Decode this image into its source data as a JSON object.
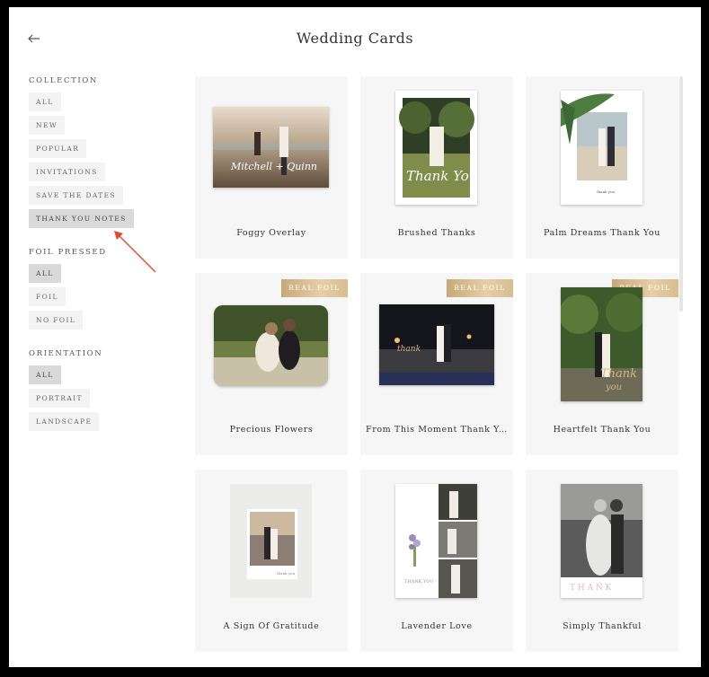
{
  "header": {
    "title": "Wedding Cards"
  },
  "sidebar": {
    "groups": [
      {
        "heading": "COLLECTION",
        "options": [
          {
            "label": "ALL",
            "active": false
          },
          {
            "label": "NEW",
            "active": false
          },
          {
            "label": "POPULAR",
            "active": false
          },
          {
            "label": "INVITATIONS",
            "active": false
          },
          {
            "label": "SAVE THE DATES",
            "active": false
          },
          {
            "label": "THANK YOU NOTES",
            "active": true
          }
        ]
      },
      {
        "heading": "FOIL PRESSED",
        "options": [
          {
            "label": "ALL",
            "active": true
          },
          {
            "label": "FOIL",
            "active": false
          },
          {
            "label": "NO FOIL",
            "active": false
          }
        ]
      },
      {
        "heading": "ORIENTATION",
        "options": [
          {
            "label": "ALL",
            "active": true
          },
          {
            "label": "PORTRAIT",
            "active": false
          },
          {
            "label": "LANDSCAPE",
            "active": false
          }
        ]
      }
    ]
  },
  "cards": [
    {
      "name": "Foggy Overlay",
      "badge": "",
      "thumb_text": "Mitchell + Quinn"
    },
    {
      "name": "Brushed Thanks",
      "badge": "",
      "thumb_text": "Thank You"
    },
    {
      "name": "Palm Dreams Thank You",
      "badge": "",
      "thumb_text": ""
    },
    {
      "name": "Precious Flowers",
      "badge": "REAL FOIL",
      "thumb_text": ""
    },
    {
      "name": "From This Moment Thank Y...",
      "badge": "REAL FOIL",
      "thumb_text": ""
    },
    {
      "name": "Heartfelt Thank You",
      "badge": "REAL FOIL",
      "thumb_text": "Thank You"
    },
    {
      "name": "A Sign Of Gratitude",
      "badge": "",
      "thumb_text": ""
    },
    {
      "name": "Lavender Love",
      "badge": "",
      "thumb_text": ""
    },
    {
      "name": "Simply Thankful",
      "badge": "",
      "thumb_text": ""
    }
  ],
  "colors": {
    "accent_foil": "#d4b684",
    "annotation_arrow": "#e2492f",
    "active_pill": "#d9d9d9",
    "card_bg": "#f6f6f6"
  },
  "icons": {
    "back": "arrow-left-icon"
  }
}
